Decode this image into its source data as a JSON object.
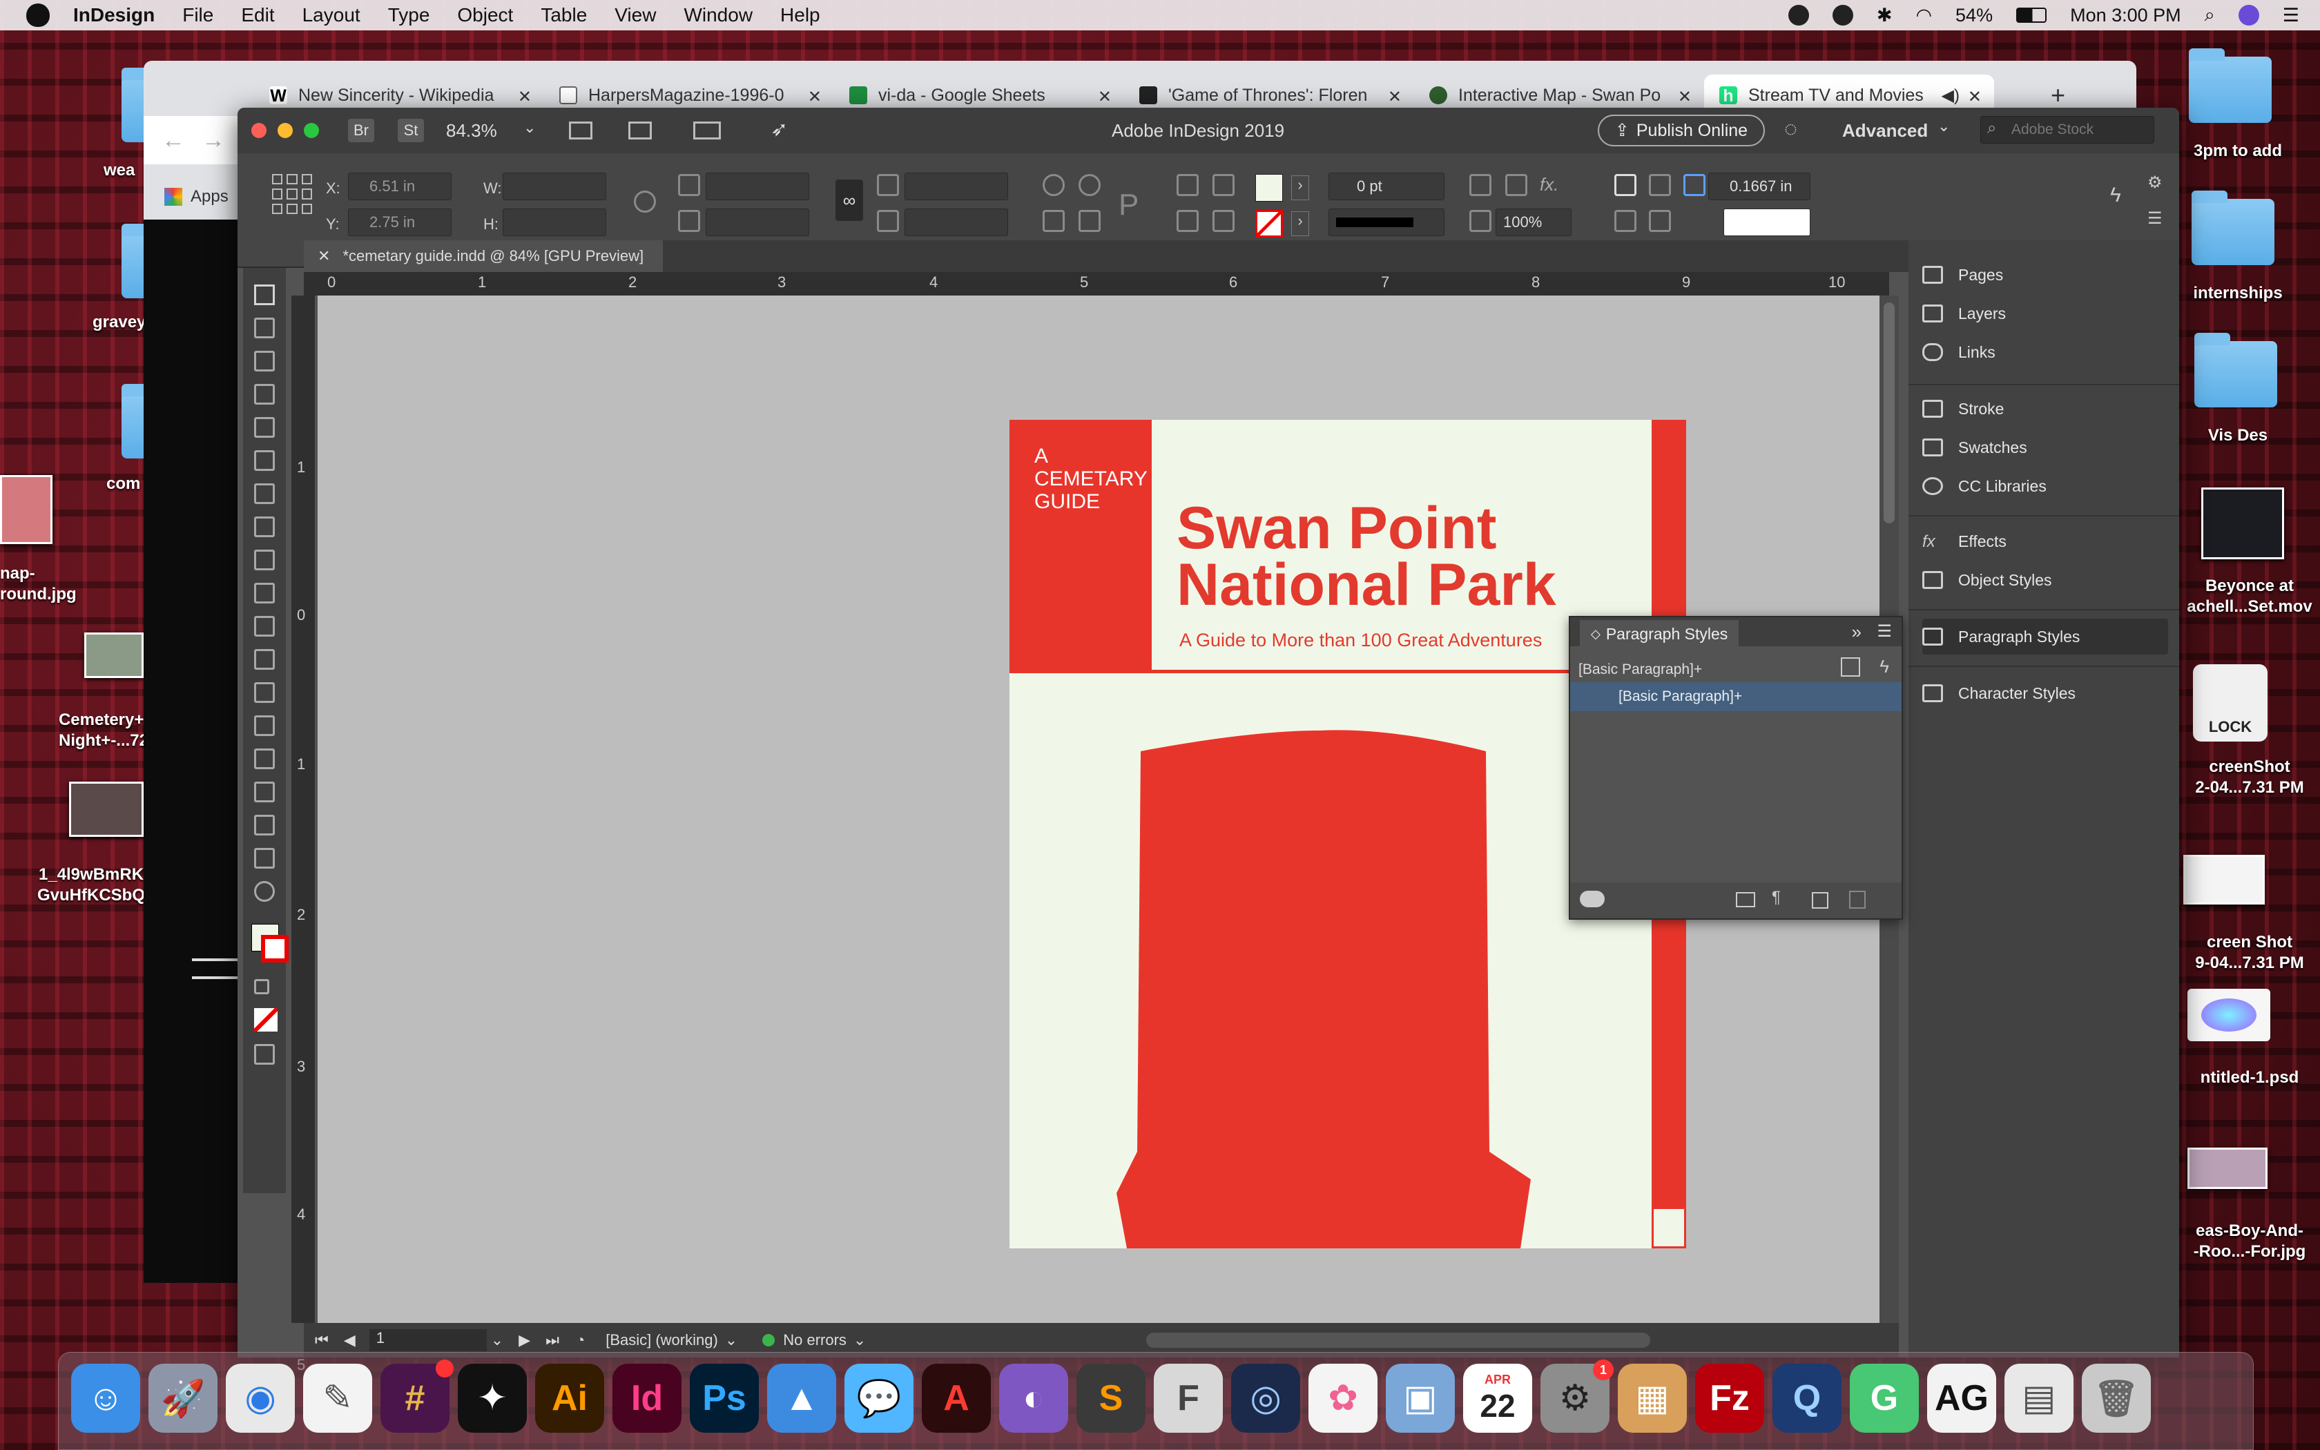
{
  "menubar": {
    "app": "InDesign",
    "items": [
      "File",
      "Edit",
      "Layout",
      "Type",
      "Object",
      "Table",
      "View",
      "Window",
      "Help"
    ],
    "battery": "54%",
    "clock": "Mon 3:00 PM"
  },
  "desktop": {
    "left_labels": [
      "wea",
      "gravey",
      "com",
      "nap-\nround.jpg",
      "Cemetery+I\nNight+-...72",
      "1_4l9wBmRK\nGvuHfKCSbQ"
    ],
    "right_labels": [
      "3pm to add",
      "internships",
      "Vis Des",
      "Beyonce at\nachell...Set.mov",
      "creenShot\n2-04...7.31 PM",
      "creen Shot\n9-04...7.31 PM",
      "ntitled-1.psd",
      "eas-Boy-And-\n-Roo...-For.jpg"
    ],
    "lock_label": "LOCK"
  },
  "chrome": {
    "tabs": [
      {
        "title": "New Sincerity - Wikipedia",
        "fav": "W"
      },
      {
        "title": "HarpersMagazine-1996-0",
        "fav": ""
      },
      {
        "title": "vi-da - Google Sheets",
        "fav": ""
      },
      {
        "title": "'Game of Thrones': Floren",
        "fav": ""
      },
      {
        "title": "Interactive Map - Swan Po",
        "fav": ""
      },
      {
        "title": "Stream TV and Movies",
        "fav": "h"
      }
    ],
    "apps_label": "Apps"
  },
  "indesign": {
    "window_title": "Adobe InDesign 2019",
    "zoom": "84.3%",
    "publish": "Publish Online",
    "workspace": "Advanced",
    "stock_search": "Adobe Stock",
    "x_label": "X:",
    "x_value": "6.51 in",
    "y_label": "Y:",
    "y_value": "2.75 in",
    "w_label": "W:",
    "h_label": "H:",
    "stroke_weight": "0 pt",
    "opacity": "100%",
    "inset": "0.1667 in",
    "doc_tab": "*cemetary guide.indd @ 84% [GPU Preview]",
    "ruler_h": [
      "0",
      "1",
      "2",
      "3",
      "4",
      "5",
      "6",
      "7",
      "8",
      "9",
      "10"
    ],
    "ruler_v": [
      "1",
      "0",
      "1",
      "2",
      "3",
      "4",
      "5"
    ],
    "status_page": "1",
    "status_profile": "[Basic] (working)",
    "status_errors": "No errors"
  },
  "document": {
    "guide_text": "A\nCEMETARY\nGUIDE",
    "title_line1": "Swan Point",
    "title_line2": "National Park",
    "subtitle": "A Guide to More than 100 Great Adventures",
    "accent": "#e8352b",
    "paper": "#f1f7e8"
  },
  "paragraph_styles_panel": {
    "title": "Paragraph Styles",
    "current": "[Basic Paragraph]+",
    "selected": "[Basic Paragraph]+"
  },
  "dock_panels": [
    "Pages",
    "Layers",
    "Links",
    "Stroke",
    "Swatches",
    "CC Libraries",
    "Effects",
    "Object Styles",
    "Paragraph Styles",
    "Character Styles"
  ],
  "macdock": {
    "apps": [
      {
        "name": "Finder",
        "glyph": "☺",
        "bg": "#3b8fe6",
        "fg": "#fff"
      },
      {
        "name": "Launchpad",
        "glyph": "🚀",
        "bg": "#8d96a8",
        "fg": "#fff"
      },
      {
        "name": "Chrome",
        "glyph": "◉",
        "bg": "#e8e8e8",
        "fg": "#2c7be5"
      },
      {
        "name": "TextEdit",
        "glyph": "✎",
        "bg": "#f3f3f3",
        "fg": "#555"
      },
      {
        "name": "Slack",
        "glyph": "#",
        "bg": "#4a154b",
        "fg": "#e4b64b"
      },
      {
        "name": "Tidal",
        "glyph": "✦",
        "bg": "#111",
        "fg": "#fff"
      },
      {
        "name": "Illustrator",
        "glyph": "Ai",
        "bg": "#331c00",
        "fg": "#ff9a00"
      },
      {
        "name": "InDesign",
        "glyph": "Id",
        "bg": "#49021f",
        "fg": "#ff3d8b"
      },
      {
        "name": "Photoshop",
        "glyph": "Ps",
        "bg": "#001d34",
        "fg": "#31a8ff"
      },
      {
        "name": "Keynote",
        "glyph": "▲",
        "bg": "#3d8be0",
        "fg": "#fff"
      },
      {
        "name": "Messages",
        "glyph": "💬",
        "bg": "#4fb6ff",
        "fg": "#fff"
      },
      {
        "name": "Acrobat",
        "glyph": "A",
        "bg": "#2b0b0b",
        "fg": "#ff3b30"
      },
      {
        "name": "GitHub",
        "glyph": "◐",
        "bg": "#7e57c2",
        "fg": "#fff"
      },
      {
        "name": "Sublime",
        "glyph": "S",
        "bg": "#3a3a3a",
        "fg": "#ff9800"
      },
      {
        "name": "FontExplorer",
        "glyph": "F",
        "bg": "#d8d8d8",
        "fg": "#444"
      },
      {
        "name": "Cinema4D",
        "glyph": "◎",
        "bg": "#1b2a4a",
        "fg": "#9cc8ff"
      },
      {
        "name": "Photos",
        "glyph": "✿",
        "bg": "#f4f4f4",
        "fg": "#f06292"
      },
      {
        "name": "Preview",
        "glyph": "▣",
        "bg": "#7aa6d8",
        "fg": "#fff"
      },
      {
        "name": "Calendar",
        "glyph": "22",
        "bg": "#ffffff",
        "fg": "#222"
      },
      {
        "name": "Preferences",
        "glyph": "⚙",
        "bg": "#8d8d8d",
        "fg": "#222"
      },
      {
        "name": "Calculator",
        "glyph": "▦",
        "bg": "#d8a05a",
        "fg": "#fff"
      },
      {
        "name": "FileZilla",
        "glyph": "Fz",
        "bg": "#b7000b",
        "fg": "#fff"
      },
      {
        "name": "QuickTime",
        "glyph": "Q",
        "bg": "#1c3b72",
        "fg": "#9fd0ff"
      },
      {
        "name": "Grammarly",
        "glyph": "G",
        "bg": "#48c774",
        "fg": "#fff"
      },
      {
        "name": "Font Book",
        "glyph": "AG",
        "bg": "#f2f2f2",
        "fg": "#111"
      },
      {
        "name": "Documents",
        "glyph": "▤",
        "bg": "#e8e8e8",
        "fg": "#555"
      },
      {
        "name": "Trash",
        "glyph": "🗑",
        "bg": "#c9c9c9",
        "fg": "#666"
      }
    ],
    "calendar_month": "APR",
    "calendar_day": "22",
    "prefs_badge": "1"
  }
}
